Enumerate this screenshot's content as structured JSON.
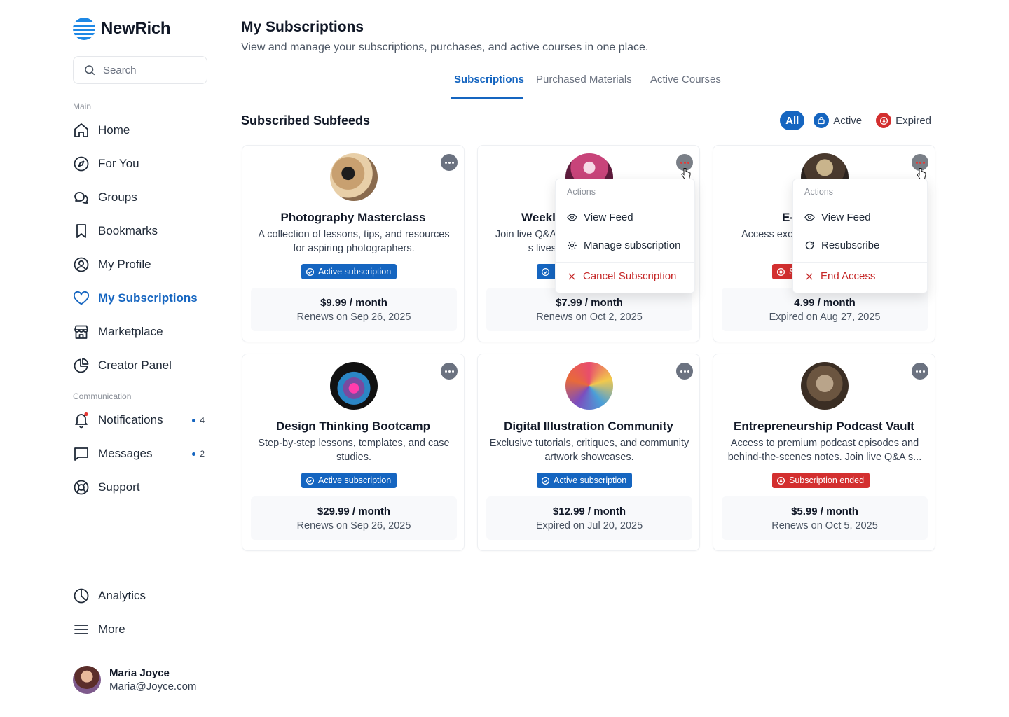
{
  "app": {
    "name": "NewRich"
  },
  "search": {
    "placeholder": "Search"
  },
  "nav": {
    "main_label": "Main",
    "main_items": [
      {
        "label": "Home",
        "icon": "home-icon"
      },
      {
        "label": "For You",
        "icon": "compass-icon"
      },
      {
        "label": "Groups",
        "icon": "chat-bubbles-icon"
      },
      {
        "label": "Bookmarks",
        "icon": "bookmark-icon"
      },
      {
        "label": "My Profile",
        "icon": "user-circle-icon"
      },
      {
        "label": "My Subscriptions",
        "icon": "heart-icon",
        "active": true
      },
      {
        "label": "Marketplace",
        "icon": "store-icon"
      },
      {
        "label": "Creator Panel",
        "icon": "pie-chart-icon"
      }
    ],
    "comm_label": "Communication",
    "comm_items": [
      {
        "label": "Notifications",
        "icon": "bell-icon",
        "badge": "4"
      },
      {
        "label": "Messages",
        "icon": "message-icon",
        "badge": "2"
      },
      {
        "label": "Support",
        "icon": "lifebuoy-icon"
      }
    ],
    "bottom_items": [
      {
        "label": "Analytics",
        "icon": "analytics-icon"
      },
      {
        "label": "More",
        "icon": "menu-icon"
      }
    ]
  },
  "user": {
    "name": "Maria Joyce",
    "email": "Maria@Joyce.com"
  },
  "page": {
    "title": "My Subscriptions",
    "subtitle": "View and manage your subscriptions, purchases, and active courses in one place."
  },
  "tabs": [
    "Subscriptions",
    "Purchased Materials",
    "Active Courses"
  ],
  "section": {
    "title": "Subscribed Subfeeds"
  },
  "filters": {
    "all": "All",
    "active": "Active",
    "expired": "Expired"
  },
  "colors": {
    "accent": "#1565c0",
    "danger": "#d32f2f"
  },
  "cards": [
    {
      "title": "Photography Masterclass",
      "desc": "A collection of lessons, tips, and resources for aspiring photographers.",
      "status": "Active subscription",
      "status_type": "active",
      "price": "$9.99 / month",
      "renew": "Renews on Sep 26, 2025"
    },
    {
      "title": "Weekl",
      "desc": "Join live Q&A s lives",
      "status": "",
      "status_type": "active",
      "price": "$7.99 / month",
      "renew": "Renews on Oct 2, 2025"
    },
    {
      "title": "E-",
      "desc": "Access exc",
      "status": "S",
      "status_type": "ended",
      "price": "4.99 / month",
      "renew": "Expired on Aug 27, 2025"
    },
    {
      "title": "Design Thinking Bootcamp",
      "desc": "Step-by-step lessons, templates, and case studies.",
      "status": "Active subscription",
      "status_type": "active",
      "price": "$29.99 / month",
      "renew": "Renews on Sep 26, 2025"
    },
    {
      "title": "Digital Illustration Community",
      "desc": "Exclusive tutorials, critiques, and community artwork showcases.",
      "status": "Active subscription",
      "status_type": "active",
      "price": "$12.99 / month",
      "renew": "Expired on Jul 20, 2025"
    },
    {
      "title": "Entrepreneurship Podcast Vault",
      "desc": "Access to premium podcast episodes and behind-the-scenes notes. Join live Q&A s...",
      "status": "Subscription ended",
      "status_type": "ended",
      "price": "$5.99 / month",
      "renew": "Renews on Oct 5, 2025"
    }
  ],
  "menus": {
    "active_menu": {
      "title": "Actions",
      "view": "View Feed",
      "manage": "Manage subscription",
      "cancel": "Cancel Subscription"
    },
    "expired_menu": {
      "title": "Actions",
      "view": "View Feed",
      "resubscribe": "Resubscribe",
      "end": "End Access"
    }
  }
}
